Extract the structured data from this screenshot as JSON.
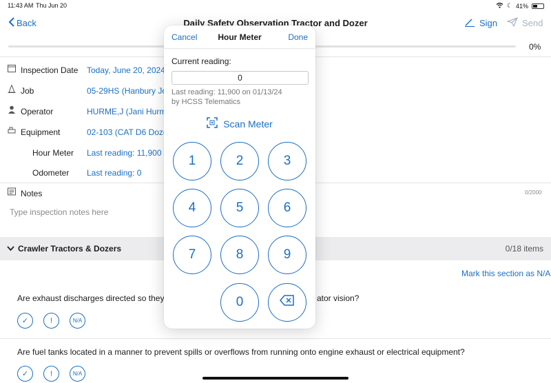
{
  "status_bar": {
    "time": "11:43 AM",
    "date": "Thu Jun 20",
    "battery": "41%"
  },
  "nav": {
    "back_label": "Back",
    "title": "Daily Safety Observation Tractor and Dozer",
    "sign_label": "Sign",
    "send_label": "Send"
  },
  "progress": {
    "percent_text": "0%",
    "value": 0
  },
  "form": {
    "inspection_date": {
      "label": "Inspection Date",
      "value": "Today, June 20, 2024"
    },
    "job": {
      "label": "Job",
      "value": "05-29HS (Hanbury Jo"
    },
    "operator": {
      "label": "Operator",
      "value": "HURME,J (Jani Hurme"
    },
    "equipment": {
      "label": "Equipment",
      "value": "02-103 (CAT D6 Doze"
    },
    "hour_meter": {
      "label": "Hour Meter",
      "value": "Last reading: 11,900"
    },
    "odometer": {
      "label": "Odometer",
      "value": "Last reading: 0"
    }
  },
  "notes": {
    "label": "Notes",
    "count": "0/2000",
    "placeholder": "Type inspection notes here"
  },
  "section": {
    "title": "Crawler Tractors & Dozers",
    "count": "0/18 items",
    "mark_na": "Mark this section as N/A"
  },
  "questions": [
    {
      "text_left": "Are exhaust discharges directed so they",
      "text_right": "ator vision?"
    },
    {
      "text": "Are fuel tanks located in a manner to prevent spills or overflows from running onto engine exhaust or electrical equipment?"
    }
  ],
  "answer_labels": {
    "ok": "✓",
    "issue": "!",
    "na": "N/A"
  },
  "popover": {
    "cancel": "Cancel",
    "title": "Hour Meter",
    "done": "Done",
    "current_label": "Current reading:",
    "current_value": "0",
    "last_reading_1": "Last reading: 11,900 on 01/13/24",
    "last_reading_2": "by HCSS Telematics",
    "scan": "Scan Meter",
    "keys": [
      "1",
      "2",
      "3",
      "4",
      "5",
      "6",
      "7",
      "8",
      "9",
      "0"
    ]
  },
  "colors": {
    "accent": "#1a6fc4",
    "section_bg": "#ececee"
  }
}
